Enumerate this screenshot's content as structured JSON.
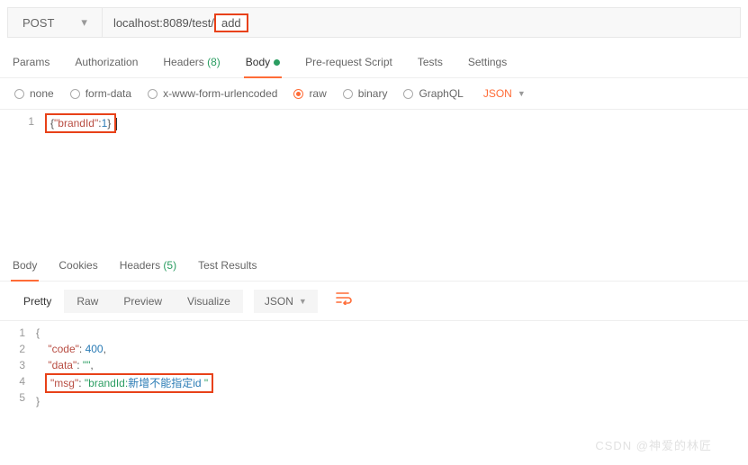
{
  "method": "POST",
  "url_prefix": "localhost:8089/test/",
  "url_highlight": "add",
  "tabs": {
    "params": "Params",
    "authorization": "Authorization",
    "headers": "Headers",
    "headers_count": "(8)",
    "body": "Body",
    "prerequest": "Pre-request Script",
    "tests": "Tests",
    "settings": "Settings"
  },
  "body_types": {
    "none": "none",
    "formdata": "form-data",
    "urlencoded": "x-www-form-urlencoded",
    "raw": "raw",
    "binary": "binary",
    "graphql": "GraphQL"
  },
  "format": "JSON",
  "request_body": {
    "line1_key": "\"brandId\"",
    "line1_val": "1"
  },
  "response_tabs": {
    "body": "Body",
    "cookies": "Cookies",
    "headers": "Headers",
    "headers_count": "(5)",
    "test_results": "Test Results"
  },
  "view_modes": {
    "pretty": "Pretty",
    "raw": "Raw",
    "preview": "Preview",
    "visualize": "Visualize"
  },
  "response_format": "JSON",
  "response": {
    "l1": "{",
    "l2_key": "\"code\"",
    "l2_val": "400",
    "l3_key": "\"data\"",
    "l3_val": "\"\"",
    "l4_key": "\"msg\"",
    "l4_val_pre": "\"brandId:",
    "l4_val_cn": "新增不能指定id",
    "l4_val_suf": " \"",
    "l5": "}"
  },
  "watermark": "CSDN @神爱的林匠"
}
